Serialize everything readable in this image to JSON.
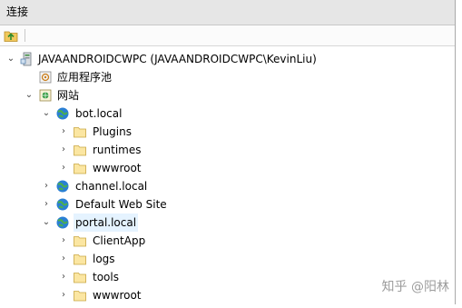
{
  "panel": {
    "title": "连接"
  },
  "tree": {
    "server": {
      "label": "JAVAANDROIDCWPC (JAVAANDROIDCWPC\\KevinLiu)"
    },
    "app_pool": {
      "label": "应用程序池"
    },
    "sites": {
      "label": "网站"
    },
    "bot": {
      "label": "bot.local",
      "children": [
        "Plugins",
        "runtimes",
        "wwwroot"
      ]
    },
    "channel": {
      "label": "channel.local"
    },
    "default_site": {
      "label": "Default Web Site"
    },
    "portal": {
      "label": "portal.local",
      "children": [
        "ClientApp",
        "logs",
        "tools",
        "wwwroot"
      ]
    }
  },
  "watermark": "知乎 @阳林",
  "colors": {
    "selection": "#e5f3ff",
    "header_bg": "#e6e6e6",
    "folder": "#f5d77f",
    "globe": "#2a7fd4"
  }
}
